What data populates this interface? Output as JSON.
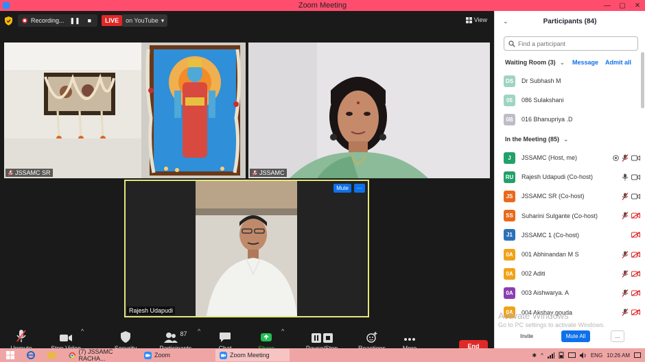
{
  "window": {
    "title": "Zoom Meeting",
    "minimize": "—",
    "maximize": "▢",
    "close": "✕"
  },
  "topbar": {
    "recording_label": "Recording...",
    "pause_glyph": "❚❚",
    "stop_glyph": "■",
    "live_label": "LIVE",
    "stream_label": "on YouTube",
    "stream_chevron": "▾",
    "view_label": "View"
  },
  "videos": [
    {
      "name": "JSSAMC SR",
      "muted": true
    },
    {
      "name": "JSSAMC",
      "muted": true
    },
    {
      "name": "Rajesh Udapudi",
      "muted": false
    }
  ],
  "spotlight": {
    "mute_label": "Mute",
    "more_label": "···"
  },
  "toolbar": {
    "unmute": "Unmute",
    "stop_video": "Stop Video",
    "security": "Security",
    "participants": "Participants",
    "participants_count": "87",
    "chat": "Chat",
    "share_screen": "Share Screen",
    "recording": "Pause/Stop Recording",
    "reactions": "Reactions",
    "more": "More",
    "end": "End",
    "caret": "^"
  },
  "panel": {
    "title": "Participants (84)",
    "collapse_chevron": "⌄",
    "search_placeholder": "Find a participant",
    "waiting_room": {
      "title": "Waiting Room (3)",
      "chevron": "⌄",
      "message": "Message",
      "admit_all": "Admit all"
    },
    "waiting": [
      {
        "initials": "DS",
        "name": "Dr Subhash M",
        "color": "#9fd4c4"
      },
      {
        "initials": "05",
        "name": "086 Sulakshani",
        "color": "#9fd4c4"
      },
      {
        "initials": "0B",
        "name": "016 Bhanupriya .D",
        "color": "#bdbdc8"
      }
    ],
    "in_meeting_title": "In the Meeting (85)",
    "in_meeting_chevron": "⌄",
    "participants": [
      {
        "initials": "J",
        "name": "JSSAMC (Host, me)",
        "color": "#21a16b",
        "icons": [
          "share",
          "mic-off",
          "cam"
        ]
      },
      {
        "initials": "RU",
        "name": "Rajesh Udapudi (Co-host)",
        "color": "#21a16b",
        "icons": [
          "mic",
          "cam"
        ]
      },
      {
        "initials": "JS",
        "name": "JSSAMC SR (Co-host)",
        "color": "#e86a1a",
        "icons": [
          "mic-off",
          "cam"
        ]
      },
      {
        "initials": "SS",
        "name": "Suharini Sulgante (Co-host)",
        "color": "#e86a1a",
        "icons": [
          "mic-off",
          "cam-off"
        ]
      },
      {
        "initials": "J1",
        "name": "JSSAMC 1 (Co-host)",
        "color": "#2d72b8",
        "icons": [
          "cam-off"
        ]
      },
      {
        "initials": "0A",
        "name": "001 Abhinandan M S",
        "color": "#f0a218",
        "icons": [
          "mic-off",
          "cam-off"
        ]
      },
      {
        "initials": "0A",
        "name": "002 Aditi",
        "color": "#f0a218",
        "icons": [
          "mic-off",
          "cam-off"
        ]
      },
      {
        "initials": "0A",
        "name": "003 Aishwarya. A",
        "color": "#8b3fb0",
        "icons": [
          "mic-off",
          "cam-off"
        ]
      },
      {
        "initials": "0A",
        "name": "004 Akshay gouda",
        "color": "#f0a218",
        "icons": [
          "mic-off",
          "cam-off"
        ]
      }
    ],
    "watermark_title": "Activate Windows",
    "watermark_sub": "Go to PC settings to activate Windows.",
    "invite": "Invite",
    "mute_all": "Mute All",
    "more": "..."
  },
  "taskbar": {
    "items": [
      {
        "label": "(7) JSSAMC RACHA...",
        "icon": "chrome-icon",
        "active": false
      },
      {
        "label": "Zoom",
        "icon": "zoom-icon",
        "active": false
      },
      {
        "label": "Zoom Meeting",
        "icon": "zoom-icon",
        "active": true
      }
    ],
    "language": "ENG",
    "time": "10:26 AM"
  },
  "colors": {
    "accent": "#0e71eb",
    "end": "#e02828",
    "share": "#21c053",
    "titlebar": "#ff4d6d",
    "taskbar": "#f0a5a5",
    "spotlight_border": "#e8e87a"
  }
}
